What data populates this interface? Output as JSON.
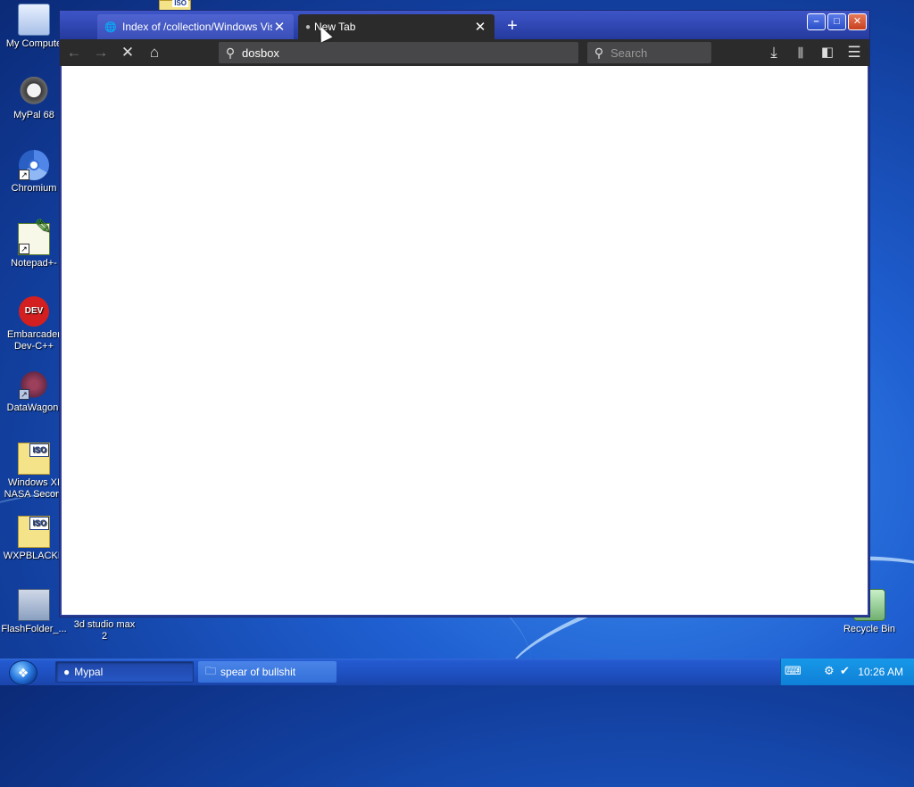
{
  "desktop": {
    "icons": [
      {
        "label": "My Compute"
      },
      {
        "label": "MyPal 68"
      },
      {
        "label": "Chromium"
      },
      {
        "label": "Notepad+-"
      },
      {
        "label": "Embarcader\nDev-C++"
      },
      {
        "label": "DataWagon."
      },
      {
        "label": "Windows XI\nNASA Secon."
      },
      {
        "label": "WXPBLACKB"
      },
      {
        "label": "FlashFolder_..."
      },
      {
        "label": "3d studio max\n2"
      },
      {
        "label": "Recycle Bin"
      }
    ]
  },
  "browser": {
    "tabs": [
      {
        "title": "Index of /collection/Windows Vista"
      },
      {
        "title": "New Tab"
      }
    ],
    "new_tab_symbol": "+",
    "urlbar": {
      "value": "dosbox"
    },
    "searchbox": {
      "placeholder": "Search"
    },
    "window_controls": {
      "minimize": "–",
      "maximize": "□",
      "close": "✕"
    }
  },
  "taskbar": {
    "buttons": [
      {
        "label": "Mypal"
      },
      {
        "label": "spear of bullshit"
      }
    ],
    "clock": "10:26 AM"
  },
  "icons": {
    "back": "arrow-left-icon",
    "forward": "arrow-right-icon",
    "stop": "close-icon",
    "home": "home-icon",
    "downloads": "download-icon",
    "library": "library-icon",
    "sidebar": "sidebar-icon",
    "menu": "hamburger-menu-icon"
  },
  "colors": {
    "window_frame": "#2c3e9a",
    "toolbar": "#2b2b2b",
    "urlbar_bg": "#474749",
    "taskbar": "#245ad0",
    "tray": "#1798e8"
  }
}
